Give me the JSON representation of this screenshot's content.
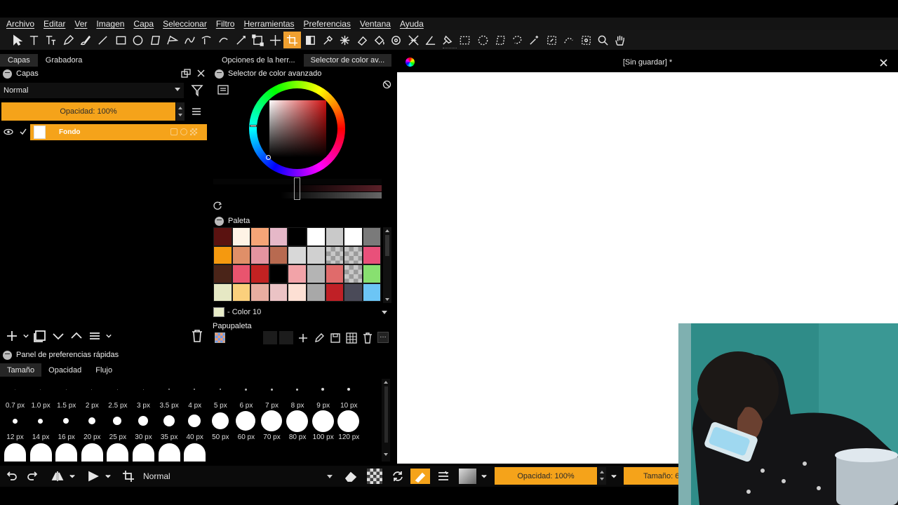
{
  "menu": [
    "Archivo",
    "Editar",
    "Ver",
    "Imagen",
    "Capa",
    "Seleccionar",
    "Filtro",
    "Herramientas",
    "Preferencias",
    "Ventana",
    "Ayuda"
  ],
  "toolbar": {
    "tools": [
      "select-icon",
      "text-icon",
      "text-warp-icon",
      "pen-icon",
      "brush-icon",
      "line-icon",
      "rectangle-icon",
      "ellipse-icon",
      "polygon-icon",
      "polyline-icon",
      "bezier-icon",
      "freehand-path-icon",
      "bezier-edit-icon",
      "path-edit-icon",
      "transform-icon",
      "move-icon",
      "crop-icon",
      "gradient-icon",
      "eyedropper-icon",
      "magic-icon",
      "eraser-icon",
      "fill-icon",
      "pattern-icon",
      "warp-icon",
      "measure-icon",
      "assistant-icon",
      "rect-select-icon",
      "ellipse-select-icon",
      "polygon-select-icon",
      "freehand-select-icon",
      "magic-wand-icon",
      "similar-select-icon",
      "bezier-select-icon",
      "magnetic-select-icon",
      "zoom-icon",
      "hand-icon"
    ],
    "active_tool": "crop-icon"
  },
  "left_panel": {
    "tabs": [
      "Capas",
      "Grabadora"
    ],
    "layers_title": "Capas",
    "blend_mode": "Normal",
    "opacity_label": "Opacidad:  100%",
    "layer_name": "Fondo"
  },
  "mid_panel": {
    "tabs": [
      "Opciones de la herr...",
      "Selector de color av..."
    ],
    "color_selector_title": "Selector de color avanzado",
    "palette_title": "Paleta",
    "color_name": "- Color 10",
    "papupaleta_label": "Papupaleta",
    "swatches": [
      "#5a1210",
      "#fff3e6",
      "#f6a577",
      "#e6b8c8",
      "#000000",
      "#ffffff",
      "#c9c9c9",
      "#ffffff",
      "#7a7a7a",
      "#f5990f",
      "#e08f68",
      "#e494a0",
      "#b86a50",
      "#d8d8d8",
      "#d0d0d0",
      "checker",
      "checker",
      "#e9507a",
      "#4a2418",
      "#e9546e",
      "#c22222",
      "#000000",
      "#f2a3a8",
      "#b4b4b4",
      "#e06b6b",
      "checker",
      "#88e070",
      "#e6e8c4",
      "#fbd07c",
      "#e8ada0",
      "#ebc3c5",
      "#fde0d4",
      "#a8a8a8",
      "#c02026",
      "#4a4a58",
      "#6cc5f5"
    ]
  },
  "quick_prefs": {
    "title": "Panel de preferencias rápidas",
    "tabs": [
      "Tamaño",
      "Opacidad",
      "Flujo"
    ],
    "row1_labels": [
      "0.7 px",
      "1.0 px",
      "1.5 px",
      "2 px",
      "2.5 px",
      "3 px",
      "3.5 px",
      "4 px",
      "5 px",
      "6 px",
      "7 px",
      "8 px",
      "9 px",
      "10 px"
    ],
    "row2_labels": [
      "12 px",
      "14 px",
      "16 px",
      "20 px",
      "25 px",
      "30 px",
      "35 px",
      "40 px",
      "50 px",
      "60 px",
      "70 px",
      "80 px",
      "100 px",
      "120 px"
    ]
  },
  "statusbar": {
    "blend_mode": "Normal",
    "opacity_label": "Opacidad: 100%",
    "size_label": "Tamaño: 6"
  },
  "canvas": {
    "title": "[Sin guardar] *"
  },
  "colors": {
    "accent": "#f5a31a",
    "panel_bg": "#000000",
    "menubar_bg": "#141414"
  }
}
